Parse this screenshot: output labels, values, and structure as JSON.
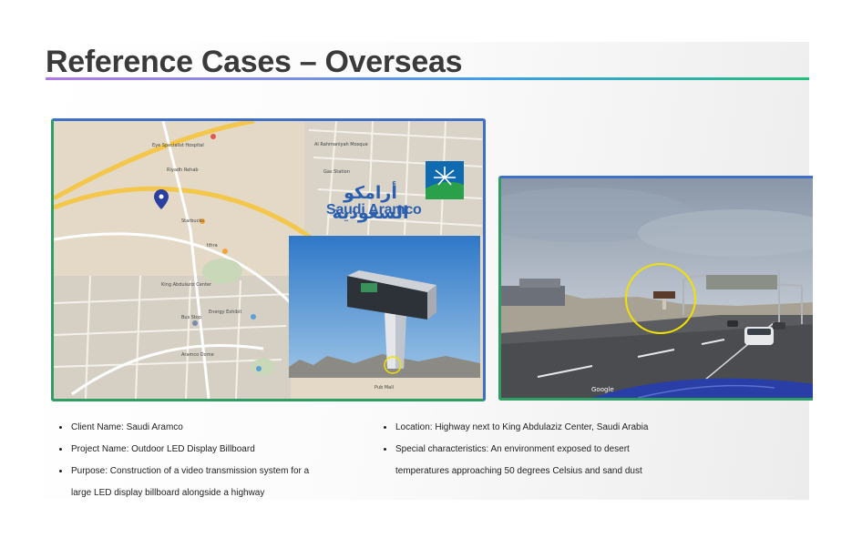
{
  "title": "Reference Cases – Overseas",
  "logo": {
    "arabic": "أرامكو السعودية",
    "english": "Saudi Aramco"
  },
  "map_labels": [
    "Eye Specialist Hospital",
    "Riyadh Rehab",
    "Starbucks",
    "Ithra",
    "King Abdulaziz Center",
    "Energy Exhibit",
    "Al Rahmaniyah Mosque",
    "Gas Station",
    "Bus Stop",
    "Aramco Dome",
    "Pub Mall"
  ],
  "street_view_mark": "Google",
  "left_bullets": [
    {
      "text": "Client Name: Saudi Aramco",
      "cont": false
    },
    {
      "text": "Project Name: Outdoor LED Display Billboard",
      "cont": false
    },
    {
      "text": "Purpose: Construction of a video transmission system for a",
      "cont": false
    },
    {
      "text": "large LED display billboard alongside a highway",
      "cont": true
    }
  ],
  "right_bullets": [
    {
      "text": "Location: Highway next to King Abdulaziz Center, Saudi Arabia",
      "cont": false
    },
    {
      "text": "Special characteristics: An environment exposed to desert",
      "cont": false
    },
    {
      "text": "temperatures approaching 50 degrees Celsius and sand dust",
      "cont": true
    }
  ],
  "colors": {
    "title": "#3a3a3a",
    "aramco_blue": "#2a5fb0",
    "frame_green": "#2f9e64",
    "frame_blue": "#3f6fc6",
    "highlight_circle": "#f2e200"
  }
}
